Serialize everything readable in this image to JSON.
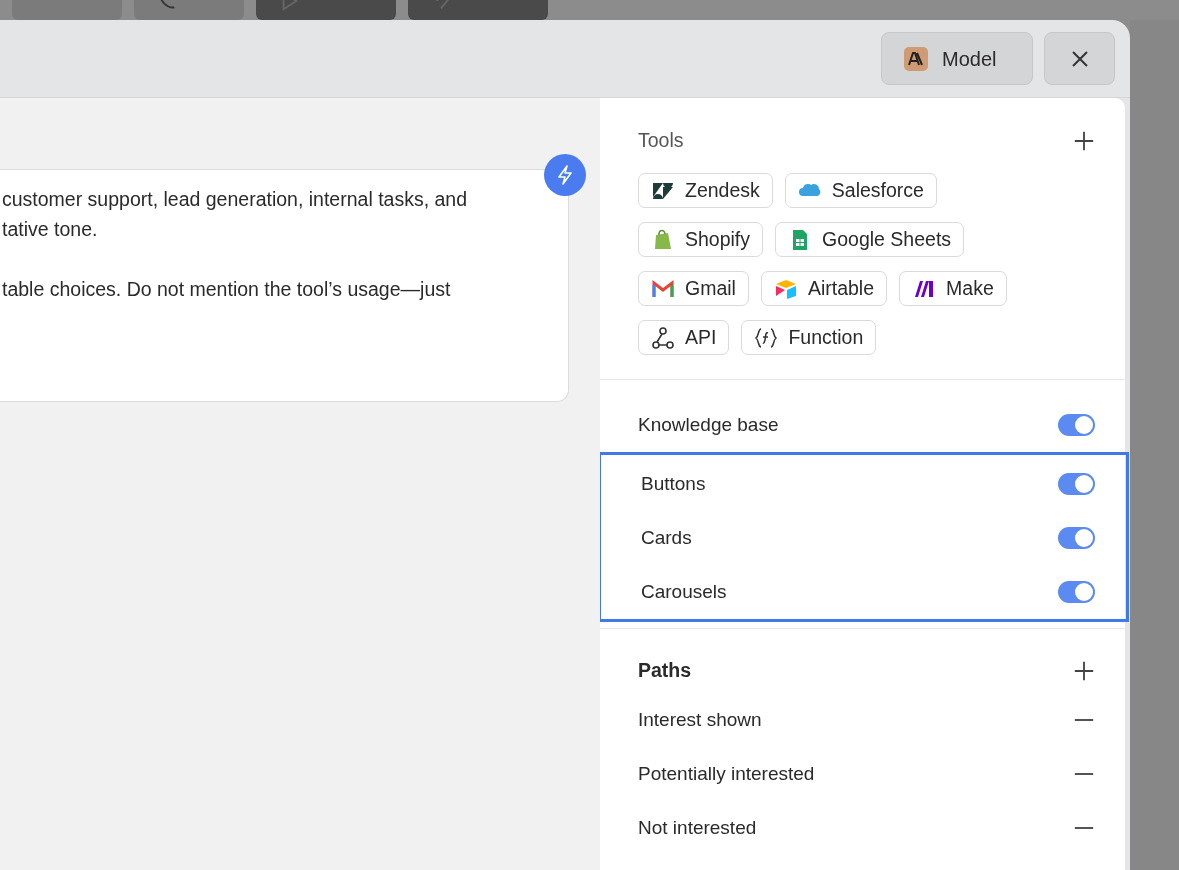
{
  "background_toolbar": [
    {
      "kind": "light"
    },
    {
      "kind": "light"
    },
    {
      "kind": "dark"
    },
    {
      "kind": "dark"
    }
  ],
  "header": {
    "model_button": {
      "label": "Model"
    }
  },
  "prompt": {
    "paragraphs": [
      "customer support, lead generation, internal tasks, and\ntative tone.",
      "table choices. Do not mention the tool’s usage—just"
    ]
  },
  "tools": {
    "title": "Tools",
    "items": [
      {
        "label": "Zendesk",
        "kind": "zendesk"
      },
      {
        "label": "Salesforce",
        "kind": "salesforce"
      },
      {
        "label": "Shopify",
        "kind": "shopify"
      },
      {
        "label": "Google Sheets",
        "kind": "sheets"
      },
      {
        "label": "Gmail",
        "kind": "gmail"
      },
      {
        "label": "Airtable",
        "kind": "airtable"
      },
      {
        "label": "Make",
        "kind": "make"
      },
      {
        "label": "API",
        "kind": "api"
      },
      {
        "label": "Function",
        "kind": "function"
      }
    ]
  },
  "toggles": [
    {
      "label": "Knowledge base",
      "on": true,
      "highlighted": false
    },
    {
      "label": "Buttons",
      "on": true,
      "highlighted": true
    },
    {
      "label": "Cards",
      "on": true,
      "highlighted": true
    },
    {
      "label": "Carousels",
      "on": true,
      "highlighted": true
    }
  ],
  "paths": {
    "title": "Paths",
    "items": [
      {
        "label": "Interest shown"
      },
      {
        "label": "Potentially interested"
      },
      {
        "label": "Not interested"
      }
    ]
  }
}
